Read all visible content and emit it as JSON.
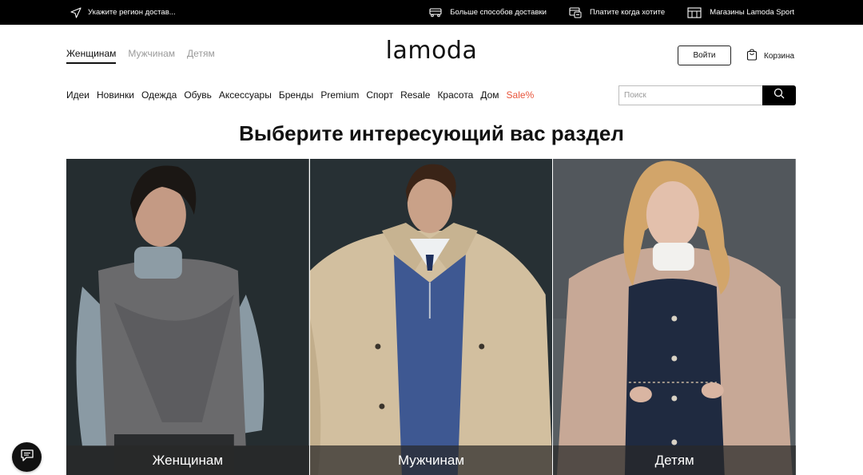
{
  "topbar": {
    "region": "Укажите регион достав...",
    "links": [
      {
        "label": "Больше способов доставки",
        "icon": "truck-icon"
      },
      {
        "label": "Платите когда хотите",
        "icon": "payment-icon"
      },
      {
        "label": "Магазины Lamoda Sport",
        "icon": "store-icon"
      }
    ]
  },
  "header": {
    "gender_tabs": [
      {
        "label": "Женщинам",
        "active": true
      },
      {
        "label": "Мужчинам",
        "active": false
      },
      {
        "label": "Детям",
        "active": false
      }
    ],
    "logo": "lamoda",
    "login_label": "Войти",
    "cart_label": "Корзина"
  },
  "nav": {
    "items": [
      "Идеи",
      "Новинки",
      "Одежда",
      "Обувь",
      "Аксессуары",
      "Бренды",
      "Premium",
      "Спорт",
      "Resale",
      "Красота",
      "Дом"
    ],
    "sale": "Sale%",
    "sale_color": "#e8543a"
  },
  "search": {
    "placeholder": "Поиск"
  },
  "headline": "Выберите интересующий вас раздел",
  "cards": [
    {
      "label": "Женщинам"
    },
    {
      "label": "Мужчинам"
    },
    {
      "label": "Детям"
    }
  ]
}
